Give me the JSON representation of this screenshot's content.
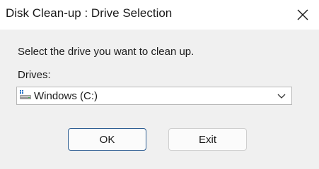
{
  "window": {
    "title": "Disk Clean-up : Drive Selection"
  },
  "content": {
    "prompt": "Select the drive you want to clean up.",
    "drives_label": "Drives:",
    "selected_drive": "Windows (C:)"
  },
  "buttons": {
    "ok_label": "OK",
    "exit_label": "Exit"
  },
  "icons": {
    "close": "close-icon",
    "drive": "hard-drive-icon",
    "dropdown": "chevron-down-icon"
  },
  "colors": {
    "titlebar_bg": "#ffffff",
    "dialog_bg": "#f0f0f0",
    "default_button_border": "#2f5f93"
  }
}
